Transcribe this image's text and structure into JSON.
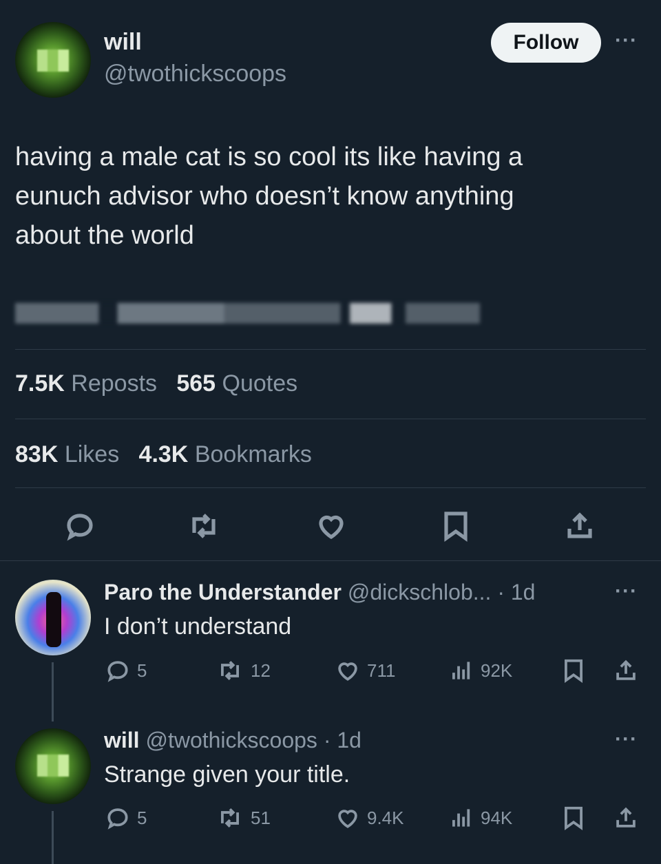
{
  "tweet": {
    "author_name": "will",
    "author_handle": "@twothickscoops",
    "follow_label": "Follow",
    "text_lines": [
      "having a male cat is so cool its like having a",
      "eunuch advisor who doesn’t know anything",
      "about the world"
    ],
    "stats": {
      "reposts_value": "7.5K",
      "reposts_label": "Reposts",
      "quotes_value": "565",
      "quotes_label": "Quotes",
      "likes_value": "83K",
      "likes_label": "Likes",
      "bookmarks_value": "4.3K",
      "bookmarks_label": "Bookmarks"
    },
    "actions": [
      "reply-icon",
      "repost-icon",
      "like-icon",
      "bookmark-icon",
      "share-icon"
    ]
  },
  "replies": [
    {
      "name": "Paro the Understander",
      "handle": "@dickschlob...",
      "time": "· 1d",
      "text": "I don’t understand",
      "reply_count": "5",
      "repost_count": "12",
      "like_count": "711",
      "view_count": "92K"
    },
    {
      "name": "will",
      "handle": "@twothickscoops",
      "time": "· 1d",
      "text": "Strange given your title.",
      "reply_count": "5",
      "repost_count": "51",
      "like_count": "9.4K",
      "view_count": "94K"
    }
  ],
  "colors": {
    "background": "#15202b",
    "text": "#e7e9ea",
    "muted": "#8b98a5",
    "divider": "#2f3b47",
    "follow_bg": "#eff3f4"
  }
}
